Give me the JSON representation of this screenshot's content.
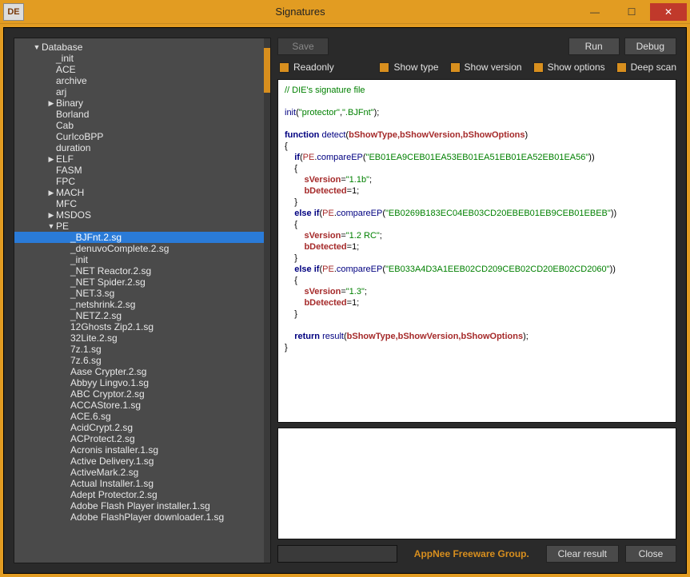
{
  "window": {
    "title": "Signatures",
    "icon_text": "DE"
  },
  "buttons": {
    "save": "Save",
    "run": "Run",
    "debug": "Debug",
    "clear": "Clear result",
    "close": "Close"
  },
  "checks": {
    "readonly": "Readonly",
    "show_type": "Show type",
    "show_version": "Show version",
    "show_options": "Show options",
    "deep_scan": "Deep scan"
  },
  "brand": "AppNee Freeware Group.",
  "tree": {
    "root": {
      "label": "Database",
      "expanded": true
    },
    "items": [
      {
        "label": "_init",
        "indent": 2,
        "arrow": ""
      },
      {
        "label": "ACE",
        "indent": 2,
        "arrow": ""
      },
      {
        "label": "archive",
        "indent": 2,
        "arrow": ""
      },
      {
        "label": "arj",
        "indent": 2,
        "arrow": ""
      },
      {
        "label": "Binary",
        "indent": 2,
        "arrow": "right"
      },
      {
        "label": "Borland",
        "indent": 2,
        "arrow": ""
      },
      {
        "label": "Cab",
        "indent": 2,
        "arrow": ""
      },
      {
        "label": "CurIcoBPP",
        "indent": 2,
        "arrow": ""
      },
      {
        "label": "duration",
        "indent": 2,
        "arrow": ""
      },
      {
        "label": "ELF",
        "indent": 2,
        "arrow": "right"
      },
      {
        "label": "FASM",
        "indent": 2,
        "arrow": ""
      },
      {
        "label": "FPC",
        "indent": 2,
        "arrow": ""
      },
      {
        "label": "MACH",
        "indent": 2,
        "arrow": "right"
      },
      {
        "label": "MFC",
        "indent": 2,
        "arrow": ""
      },
      {
        "label": "MSDOS",
        "indent": 2,
        "arrow": "right"
      },
      {
        "label": "PE",
        "indent": 2,
        "arrow": "down"
      },
      {
        "label": "_BJFnt.2.sg",
        "indent": 3,
        "arrow": "",
        "selected": true
      },
      {
        "label": "_denuvoComplete.2.sg",
        "indent": 3,
        "arrow": ""
      },
      {
        "label": "_init",
        "indent": 3,
        "arrow": ""
      },
      {
        "label": "_NET Reactor.2.sg",
        "indent": 3,
        "arrow": ""
      },
      {
        "label": "_NET Spider.2.sg",
        "indent": 3,
        "arrow": ""
      },
      {
        "label": "_NET.3.sg",
        "indent": 3,
        "arrow": ""
      },
      {
        "label": "_netshrink.2.sg",
        "indent": 3,
        "arrow": ""
      },
      {
        "label": "_NETZ.2.sg",
        "indent": 3,
        "arrow": ""
      },
      {
        "label": "12Ghosts Zip2.1.sg",
        "indent": 3,
        "arrow": ""
      },
      {
        "label": "32Lite.2.sg",
        "indent": 3,
        "arrow": ""
      },
      {
        "label": "7z.1.sg",
        "indent": 3,
        "arrow": ""
      },
      {
        "label": "7z.6.sg",
        "indent": 3,
        "arrow": ""
      },
      {
        "label": "Aase Crypter.2.sg",
        "indent": 3,
        "arrow": ""
      },
      {
        "label": "Abbyy Lingvo.1.sg",
        "indent": 3,
        "arrow": ""
      },
      {
        "label": "ABC Cryptor.2.sg",
        "indent": 3,
        "arrow": ""
      },
      {
        "label": "ACCAStore.1.sg",
        "indent": 3,
        "arrow": ""
      },
      {
        "label": "ACE.6.sg",
        "indent": 3,
        "arrow": ""
      },
      {
        "label": "AcidCrypt.2.sg",
        "indent": 3,
        "arrow": ""
      },
      {
        "label": "ACProtect.2.sg",
        "indent": 3,
        "arrow": ""
      },
      {
        "label": "Acronis installer.1.sg",
        "indent": 3,
        "arrow": ""
      },
      {
        "label": "Active Delivery.1.sg",
        "indent": 3,
        "arrow": ""
      },
      {
        "label": "ActiveMark.2.sg",
        "indent": 3,
        "arrow": ""
      },
      {
        "label": "Actual Installer.1.sg",
        "indent": 3,
        "arrow": ""
      },
      {
        "label": "Adept Protector.2.sg",
        "indent": 3,
        "arrow": ""
      },
      {
        "label": "Adobe Flash Player installer.1.sg",
        "indent": 3,
        "arrow": ""
      },
      {
        "label": "Adobe FlashPlayer downloader.1.sg",
        "indent": 3,
        "arrow": ""
      }
    ]
  },
  "code": {
    "comment": "// DIE's signature file",
    "init_fn": "init",
    "init_arg1": "\"protector\"",
    "init_arg2": "\".BJFnt\"",
    "func_kw": "function",
    "func_name": "detect",
    "params": "bShowType,bShowVersion,bShowOptions",
    "pe": "PE",
    "cmp": "compareEP",
    "ep1": "\"EB01EA9CEB01EA53EB01EA51EB01EA52EB01EA56\"",
    "ep2": "\"EB0269B183EC04EB03CD20EBEB01EB9CEB01EBEB\"",
    "ep3": "\"EB033A4D3A1EEB02CD209CEB02CD20EB02CD2060\"",
    "sver": "sVersion",
    "v1": "\"1.1b\"",
    "v2": "\"1.2 RC\"",
    "v3": "\"1.3\"",
    "bdet": "bDetected",
    "one": "1",
    "if": "if",
    "else": "else",
    "return": "return",
    "result": "result"
  }
}
